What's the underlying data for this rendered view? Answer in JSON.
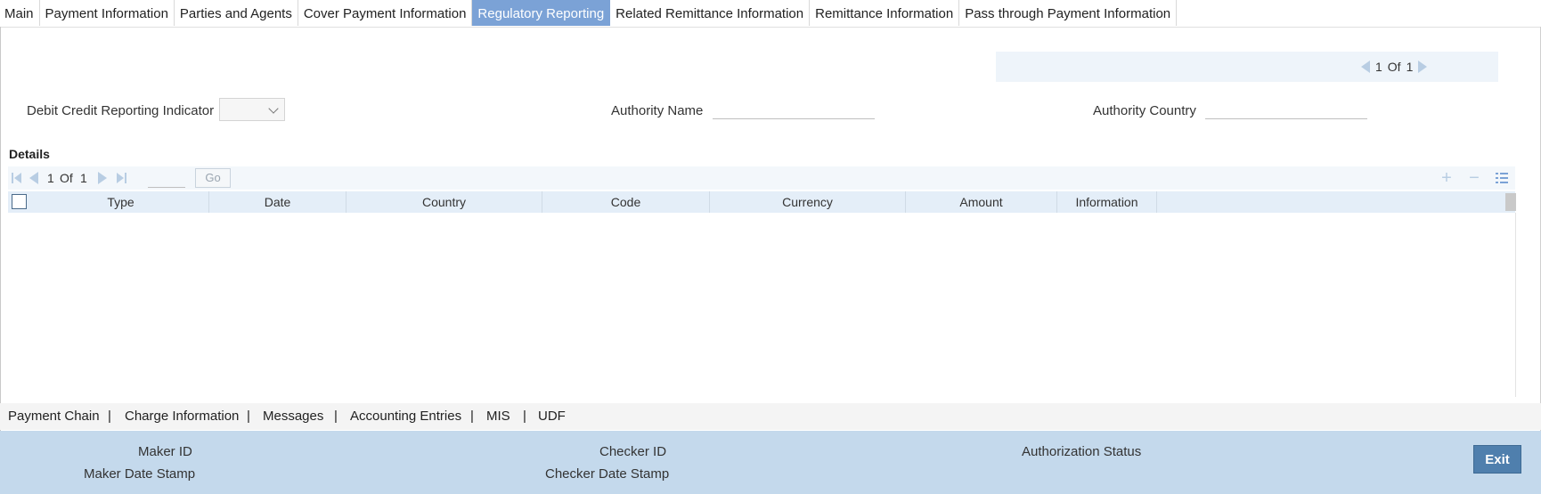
{
  "tabs": [
    {
      "label": "Main"
    },
    {
      "label": "Payment Information"
    },
    {
      "label": "Parties and Agents"
    },
    {
      "label": "Cover Payment Information"
    },
    {
      "label": "Regulatory Reporting"
    },
    {
      "label": "Related Remittance Information"
    },
    {
      "label": "Remittance Information"
    },
    {
      "label": "Pass through Payment Information"
    }
  ],
  "active_tab": "Regulatory Reporting",
  "record_pager": {
    "current": "1",
    "of": "Of",
    "total": "1"
  },
  "form": {
    "debit_credit_label": "Debit Credit Reporting Indicator",
    "debit_credit_value": "",
    "authority_name_label": "Authority Name",
    "authority_name_value": "",
    "authority_country_label": "Authority Country",
    "authority_country_value": ""
  },
  "details": {
    "title": "Details",
    "pager": {
      "current": "1",
      "of": "Of",
      "total": "1",
      "go_label": "Go"
    },
    "columns": [
      "Type",
      "Date",
      "Country",
      "Code",
      "Currency",
      "Amount",
      "Information"
    ],
    "rows": []
  },
  "bottom_links": [
    "Payment Chain",
    "Charge Information",
    "Messages",
    "Accounting Entries",
    "MIS",
    "UDF"
  ],
  "bottom_separator": "|",
  "footer": {
    "maker_id_label": "Maker ID",
    "maker_date_label": "Maker Date Stamp",
    "checker_id_label": "Checker ID",
    "checker_date_label": "Checker Date Stamp",
    "auth_status_label": "Authorization Status",
    "exit_label": "Exit"
  },
  "colors": {
    "active_tab": "#7ba2d6",
    "footer_bg": "#c4d9ec",
    "exit_button": "#4f7fad",
    "grid_header": "#e4eef8"
  },
  "icons": [
    "first-page-icon",
    "prev-page-icon",
    "next-page-icon",
    "last-page-icon",
    "add-row-icon",
    "delete-row-icon",
    "single-view-icon",
    "dropdown-chevron-icon"
  ]
}
